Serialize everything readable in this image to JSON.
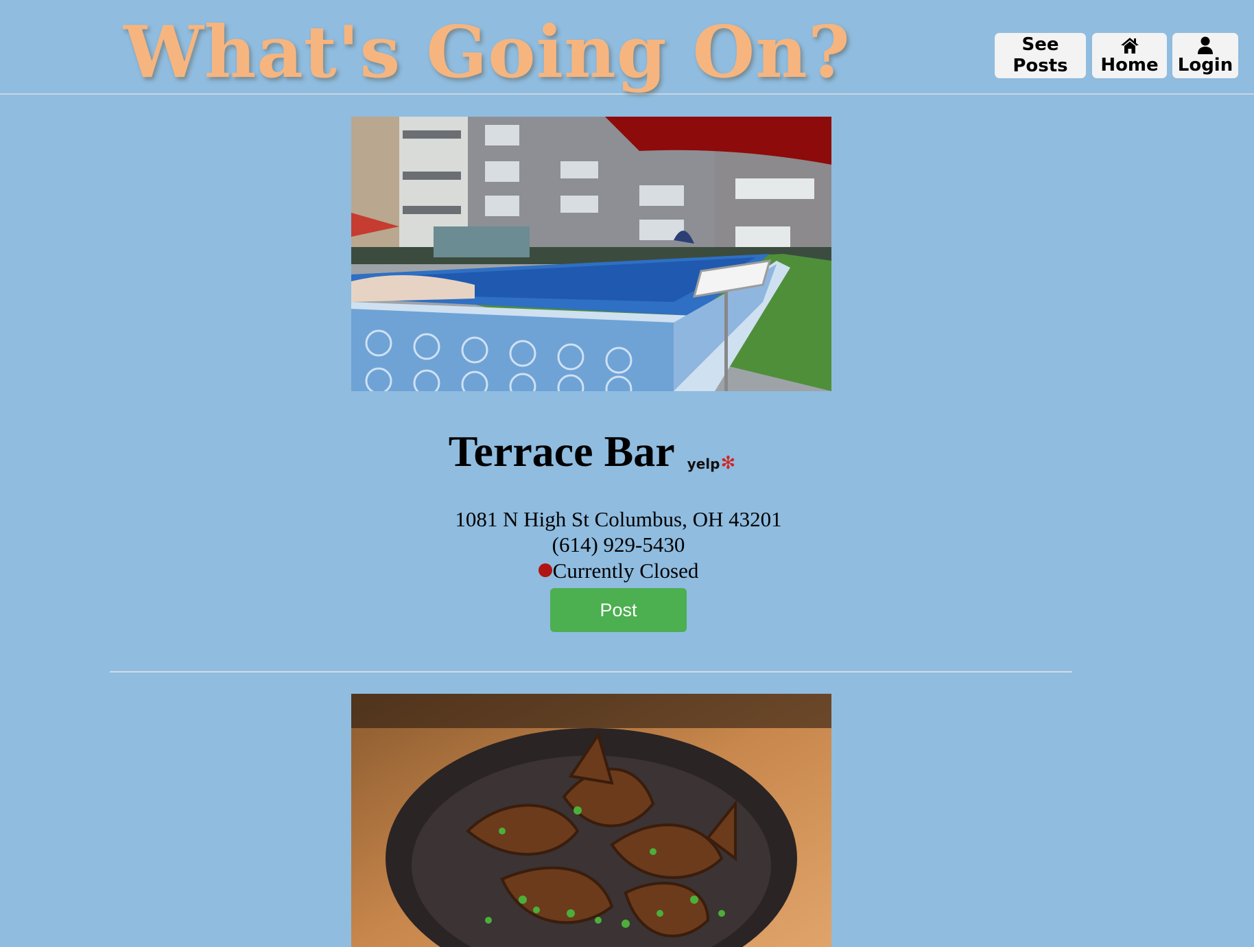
{
  "header": {
    "site_title": "What's Going On?",
    "nav": {
      "see_posts": [
        "See",
        "Posts"
      ],
      "home": "Home",
      "login": "Login"
    }
  },
  "listing": {
    "name": "Terrace Bar",
    "yelp_label": "yelp",
    "address": "1081 N High St Columbus, OH 43201",
    "phone": "(614) 929-5430",
    "status": "Currently Closed",
    "status_color": "#b01414",
    "post_button": "Post"
  },
  "colors": {
    "background": "#8fbcdf",
    "title": "#f6b57f",
    "post_button": "#4caf50"
  },
  "icons": {
    "home": "home-icon",
    "login": "user-icon",
    "yelp": "yelp-burst-icon"
  }
}
